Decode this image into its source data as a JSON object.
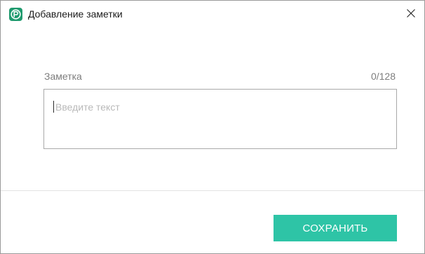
{
  "window": {
    "title": "Добавление заметки",
    "app_icon": "p-logo-icon",
    "close_icon": "close-icon"
  },
  "note": {
    "label": "Заметка",
    "counter": "0/128",
    "value": "",
    "placeholder": "Введите текст"
  },
  "footer": {
    "save_label": "СОХРАНИТЬ"
  },
  "colors": {
    "accent": "#2ec4a6",
    "app_icon": "#1f9a6e",
    "border": "#a9a9a9"
  }
}
